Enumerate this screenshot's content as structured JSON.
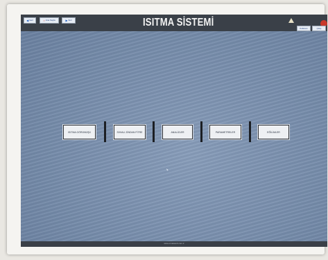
{
  "header": {
    "title": "ISITMA SİSTEMİ",
    "nav_buttons": [
      {
        "label": "Geri",
        "icon": "arrow-left-icon"
      },
      {
        "label": "Ana Sayfa",
        "icon": "home-icon"
      },
      {
        "label": "İleri",
        "icon": "arrow-right-icon"
      }
    ],
    "datetime_line1": "",
    "datetime_line2": "",
    "side_buttons": [
      {
        "label": "Kullanıcı"
      },
      {
        "label": "Çıkış"
      }
    ]
  },
  "menu": {
    "items": [
      {
        "label": "ISITMA GÖRÜNÜŞÜ"
      },
      {
        "label": "SIVIALI ZİNDAN FİTRE"
      },
      {
        "label": "ANALİZLER"
      },
      {
        "label": "PARAMETRELER"
      },
      {
        "label": "EĞİLİMLER"
      }
    ]
  },
  "footer": {
    "text": "www.ornekweb.com.tr"
  },
  "colors": {
    "screen_bg": "#6f86a6",
    "topbar": "#3a4048",
    "title_text": "#f2f2f2",
    "power_button": "#c8382b"
  }
}
